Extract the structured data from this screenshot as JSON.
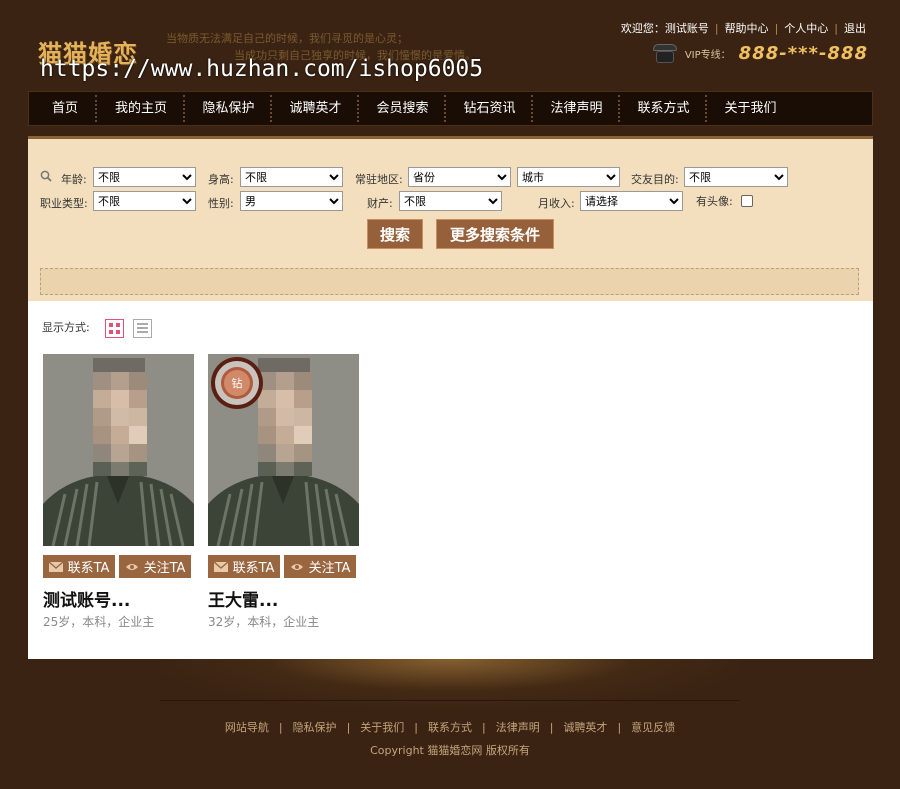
{
  "header": {
    "logo": "猫猫婚恋",
    "slogan_line1": "当物质无法满足自己的时候，我们寻觅的是心灵；",
    "slogan_line2": "当成功只剩自己独享的时候，我们憧憬的是爱情。",
    "watermark": "https://www.huzhan.com/ishop6005",
    "welcome": "欢迎您：测试账号",
    "links": [
      "帮助中心",
      "个人中心",
      "退出"
    ],
    "vip_label": "VIP专线：",
    "vip_number": "888-***-888"
  },
  "nav": {
    "items": [
      "首页",
      "我的主页",
      "隐私保护",
      "诚聘英才",
      "会员搜索",
      "钻石资讯",
      "法律声明",
      "联系方式",
      "关于我们"
    ]
  },
  "search": {
    "age_label": "年龄:",
    "age_value": "不限",
    "height_label": "身高:",
    "height_value": "不限",
    "region_label": "常驻地区:",
    "province_value": "省份",
    "city_value": "城市",
    "purpose_label": "交友目的:",
    "purpose_value": "不限",
    "job_label": "职业类型:",
    "job_value": "不限",
    "gender_label": "性别:",
    "gender_value": "男",
    "wealth_label": "财产:",
    "wealth_value": "不限",
    "income_label": "月收入:",
    "income_value": "请选择",
    "avatar_label": "有头像:",
    "search_button": "搜索",
    "more_button": "更多搜索条件"
  },
  "content": {
    "display_label": "显示方式:",
    "members": [
      {
        "name": "测试账号...",
        "info": "25岁，本科，企业主",
        "contact": "联系TA",
        "follow": "关注TA"
      },
      {
        "name": "王大雷...",
        "info": "32岁，本科，企业主",
        "contact": "联系TA",
        "follow": "关注TA",
        "badge": "钻"
      }
    ]
  },
  "footer": {
    "links": [
      "网站导航",
      "隐私保护",
      "关于我们",
      "联系方式",
      "法律声明",
      "诚聘英才",
      "意见反馈"
    ],
    "copyright": "Copyright 猫猫婚恋网 版权所有"
  }
}
